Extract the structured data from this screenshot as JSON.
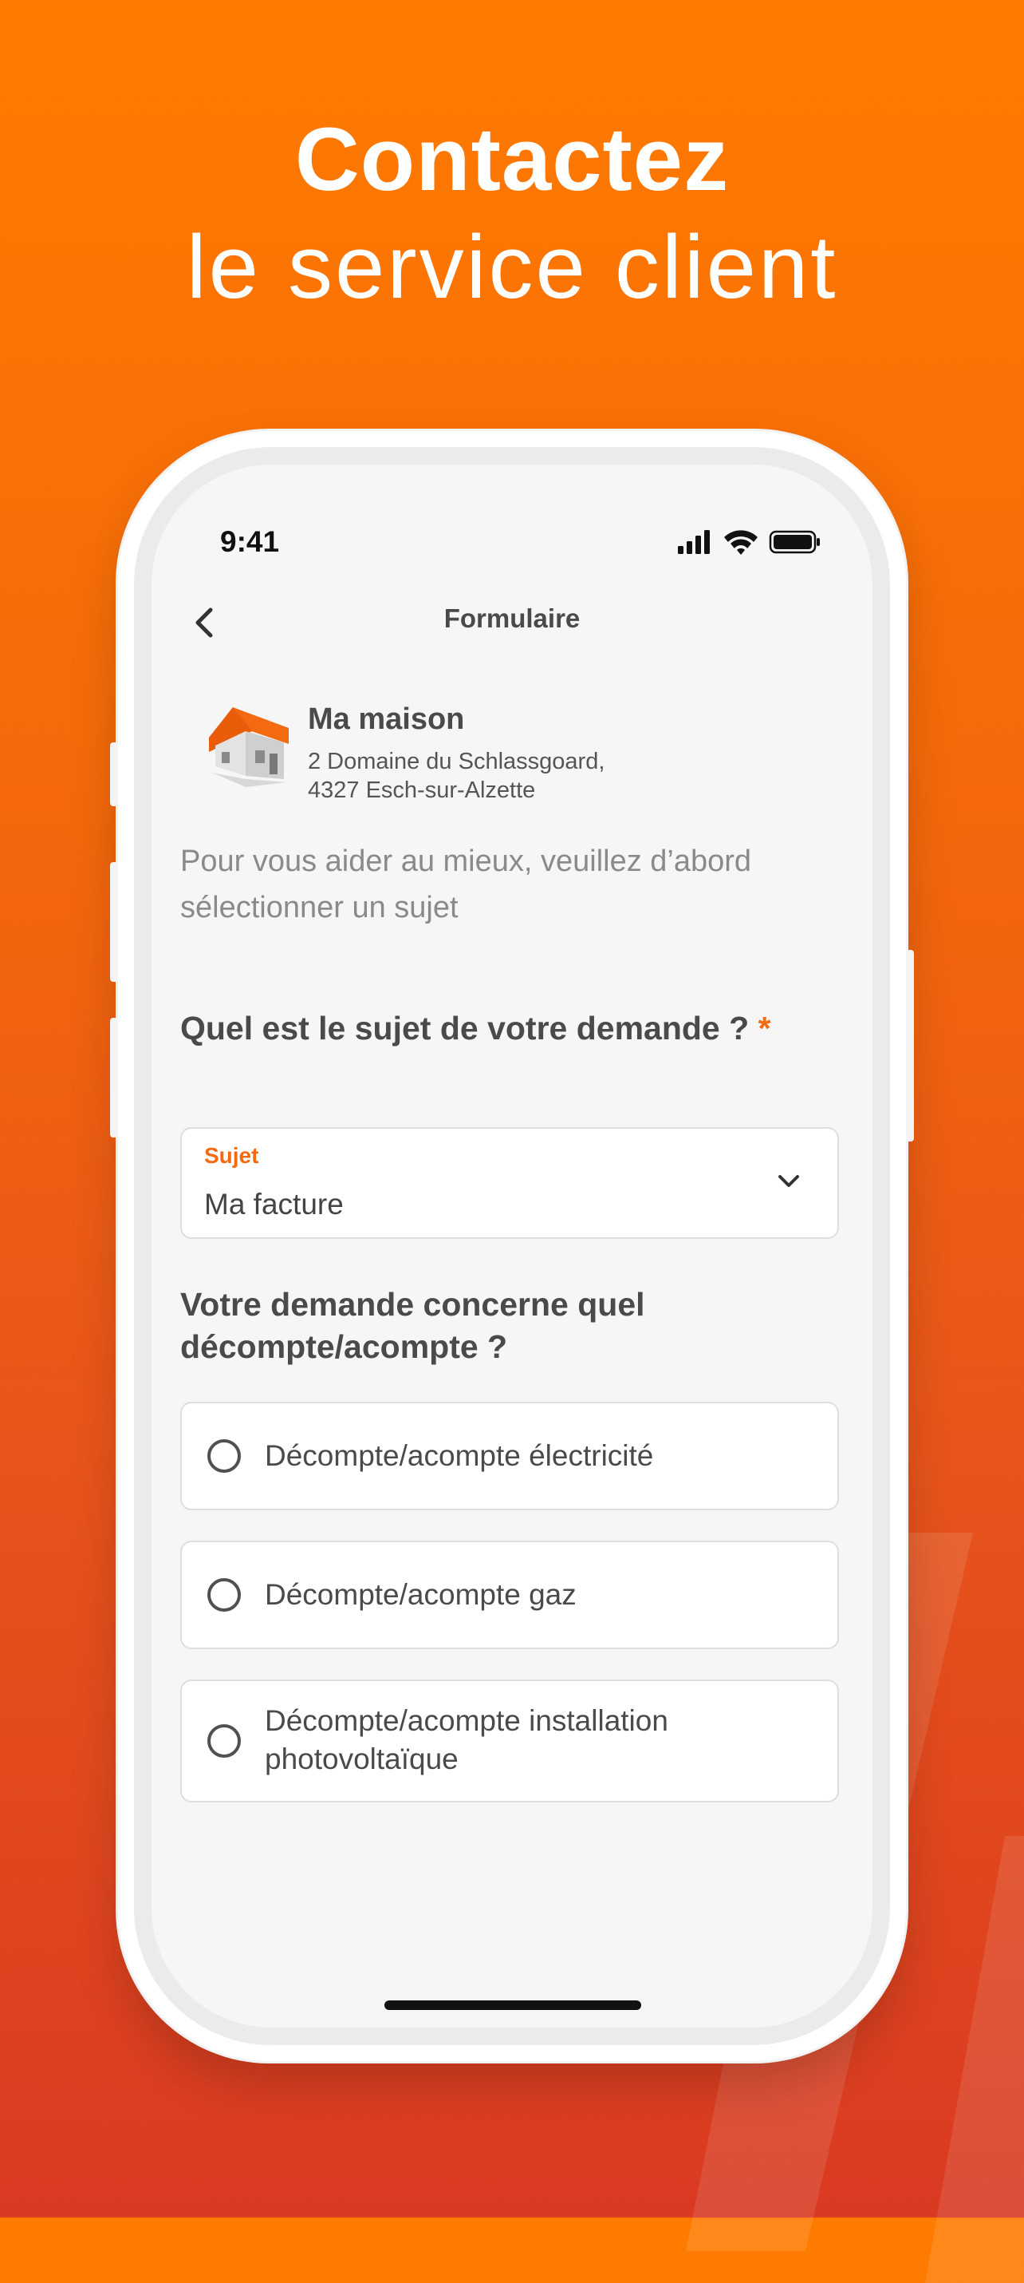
{
  "promo": {
    "title_line1": "Contactez",
    "title_line2": "le service client"
  },
  "status_bar": {
    "time": "9:41",
    "icons": [
      "signal-icon",
      "wifi-icon",
      "battery-icon"
    ]
  },
  "nav": {
    "title": "Formulaire",
    "back_icon": "chevron-left-icon"
  },
  "address": {
    "icon": "house-icon",
    "name": "Ma maison",
    "line1": "2 Domaine du Schlassgoard,",
    "line2": "4327 Esch-sur-Alzette"
  },
  "intro_text": "Pour vous aider au mieux, veuillez d’abord sélectionner un sujet",
  "question_subject": {
    "label": "Quel est le sujet de votre demande ?",
    "required_marker": "*"
  },
  "subject_select": {
    "label": "Sujet",
    "value": "Ma facture",
    "icon": "chevron-down-icon"
  },
  "question_account": {
    "label": "Votre demande concerne quel décompte/acompte ?"
  },
  "options": [
    {
      "label": "Décompte/acompte électricité",
      "selected": false
    },
    {
      "label": "Décompte/acompte gaz",
      "selected": false
    },
    {
      "label": "Décompte/acompte installation photovoltaïque",
      "selected": false
    }
  ],
  "colors": {
    "accent": "#f36a10",
    "gradient_top": "#ff7b00",
    "gradient_bottom": "#d93a22",
    "text_dark": "#4a4a4a",
    "text_muted": "#8a8a8a"
  }
}
